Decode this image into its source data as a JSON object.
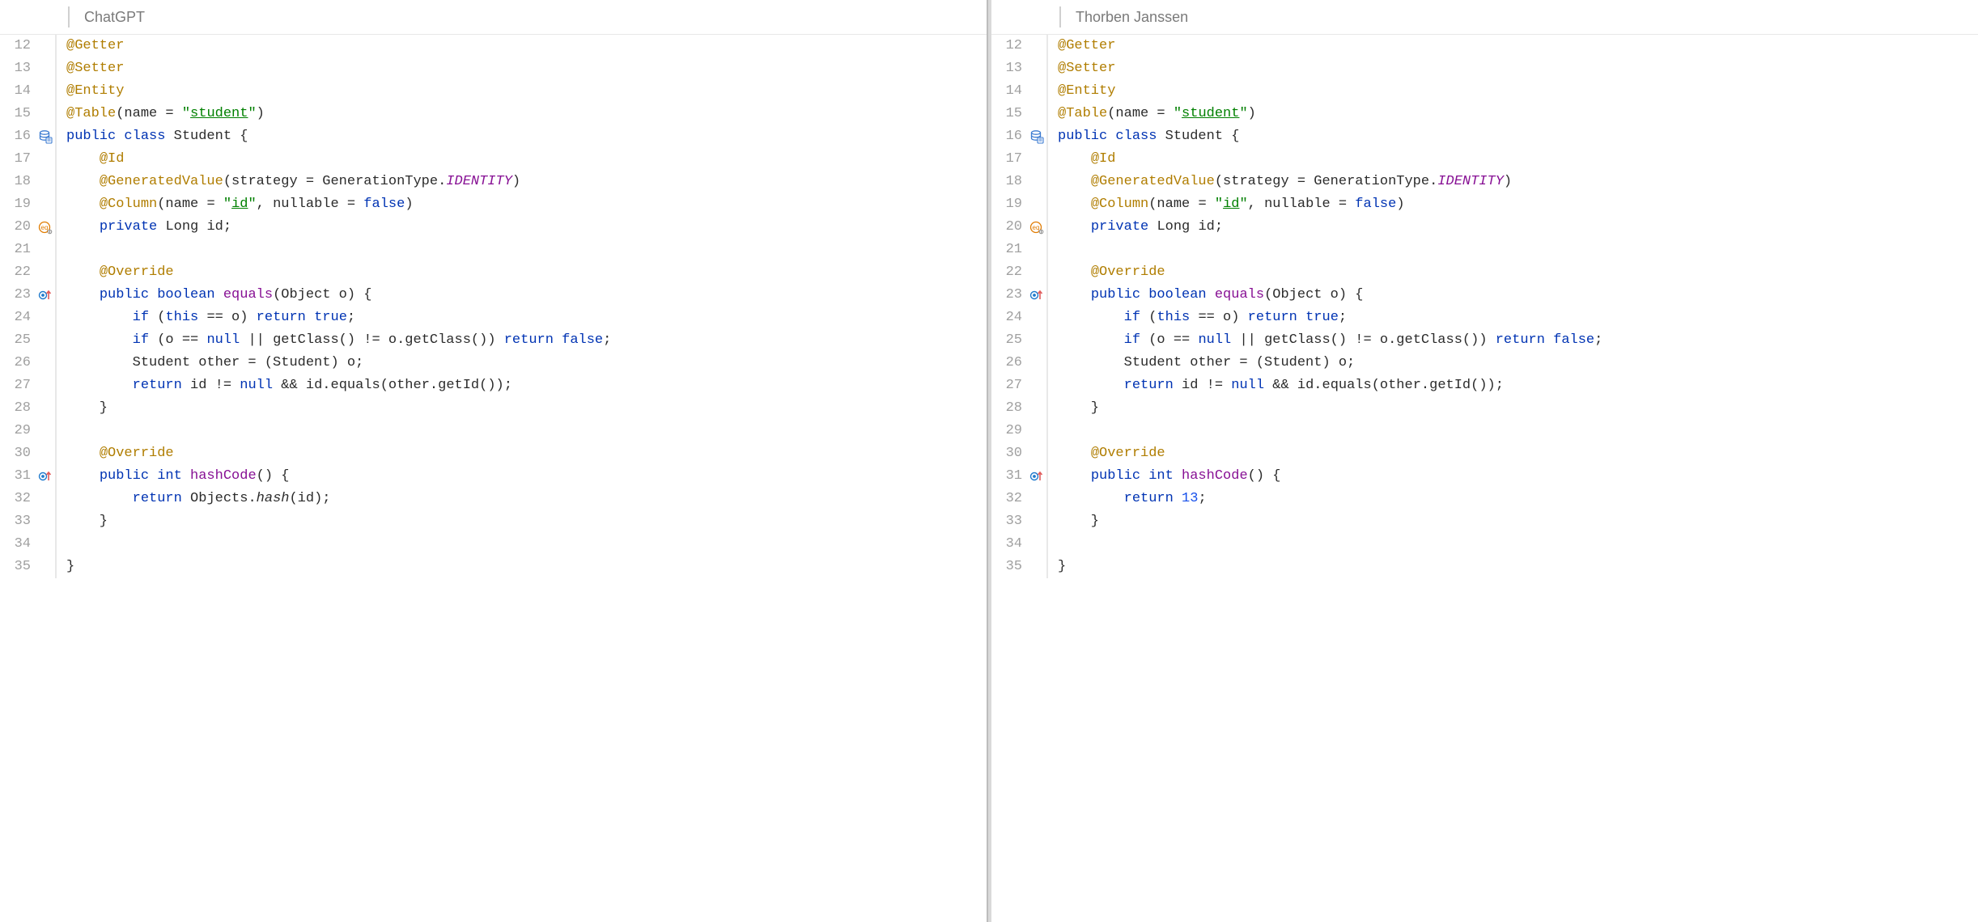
{
  "left": {
    "title": "ChatGPT",
    "lines": [
      {
        "n": 12,
        "ico": null,
        "tokens": [
          [
            "ann",
            "@Getter"
          ]
        ]
      },
      {
        "n": 13,
        "ico": null,
        "tokens": [
          [
            "ann",
            "@Setter"
          ]
        ]
      },
      {
        "n": 14,
        "ico": null,
        "tokens": [
          [
            "ann",
            "@Entity"
          ]
        ]
      },
      {
        "n": 15,
        "ico": null,
        "tokens": [
          [
            "ann",
            "@Table"
          ],
          [
            "p",
            "(name = "
          ],
          [
            "str",
            "\""
          ],
          [
            "strund",
            "student"
          ],
          [
            "str",
            "\""
          ],
          [
            "p",
            ")"
          ]
        ]
      },
      {
        "n": 16,
        "ico": "db",
        "tokens": [
          [
            "kw",
            "public class "
          ],
          [
            "p",
            "Student {"
          ]
        ]
      },
      {
        "n": 17,
        "ico": null,
        "tokens": [
          [
            "p",
            "    "
          ],
          [
            "ann",
            "@Id"
          ]
        ]
      },
      {
        "n": 18,
        "ico": null,
        "tokens": [
          [
            "p",
            "    "
          ],
          [
            "ann",
            "@GeneratedValue"
          ],
          [
            "p",
            "(strategy = GenerationType."
          ],
          [
            "id ital",
            "IDENTITY"
          ],
          [
            "p",
            ")"
          ]
        ]
      },
      {
        "n": 19,
        "ico": null,
        "tokens": [
          [
            "p",
            "    "
          ],
          [
            "ann",
            "@Column"
          ],
          [
            "p",
            "(name = "
          ],
          [
            "str",
            "\""
          ],
          [
            "strund",
            "id"
          ],
          [
            "str",
            "\""
          ],
          [
            "p",
            ", nullable = "
          ],
          [
            "bool",
            "false"
          ],
          [
            "p",
            ")"
          ]
        ]
      },
      {
        "n": 20,
        "ico": "eq",
        "tokens": [
          [
            "p",
            "    "
          ],
          [
            "kw",
            "private "
          ],
          [
            "p",
            "Long id;"
          ]
        ]
      },
      {
        "n": 21,
        "ico": null,
        "tokens": [
          [
            "p",
            ""
          ]
        ]
      },
      {
        "n": 22,
        "ico": null,
        "tokens": [
          [
            "p",
            "    "
          ],
          [
            "ann",
            "@Override"
          ]
        ]
      },
      {
        "n": 23,
        "ico": "ov",
        "tokens": [
          [
            "p",
            "    "
          ],
          [
            "kw",
            "public boolean "
          ],
          [
            "id",
            "equals"
          ],
          [
            "p",
            "(Object o) {"
          ]
        ]
      },
      {
        "n": 24,
        "ico": null,
        "tokens": [
          [
            "p",
            "        "
          ],
          [
            "kw",
            "if "
          ],
          [
            "p",
            "("
          ],
          [
            "kw",
            "this"
          ],
          [
            "p",
            " == o) "
          ],
          [
            "kw",
            "return true"
          ],
          [
            "p",
            ";"
          ]
        ]
      },
      {
        "n": 25,
        "ico": null,
        "tokens": [
          [
            "p",
            "        "
          ],
          [
            "kw",
            "if "
          ],
          [
            "p",
            "(o == "
          ],
          [
            "kw",
            "null"
          ],
          [
            "p",
            " || getClass() != o.getClass()) "
          ],
          [
            "kw",
            "return false"
          ],
          [
            "p",
            ";"
          ]
        ]
      },
      {
        "n": 26,
        "ico": null,
        "tokens": [
          [
            "p",
            "        Student other = (Student) o;"
          ]
        ]
      },
      {
        "n": 27,
        "ico": null,
        "tokens": [
          [
            "p",
            "        "
          ],
          [
            "kw",
            "return "
          ],
          [
            "p",
            "id != "
          ],
          [
            "kw",
            "null"
          ],
          [
            "p",
            " && id.equals(other.getId());"
          ]
        ]
      },
      {
        "n": 28,
        "ico": null,
        "tokens": [
          [
            "p",
            "    }"
          ]
        ]
      },
      {
        "n": 29,
        "ico": null,
        "tokens": [
          [
            "p",
            ""
          ]
        ]
      },
      {
        "n": 30,
        "ico": null,
        "tokens": [
          [
            "p",
            "    "
          ],
          [
            "ann",
            "@Override"
          ]
        ]
      },
      {
        "n": 31,
        "ico": "ov",
        "tokens": [
          [
            "p",
            "    "
          ],
          [
            "kw",
            "public int "
          ],
          [
            "id",
            "hashCode"
          ],
          [
            "p",
            "() {"
          ]
        ]
      },
      {
        "n": 32,
        "ico": null,
        "tokens": [
          [
            "p",
            "        "
          ],
          [
            "kw",
            "return "
          ],
          [
            "p",
            "Objects."
          ],
          [
            "ital",
            "hash"
          ],
          [
            "p",
            "(id);"
          ]
        ]
      },
      {
        "n": 33,
        "ico": null,
        "tokens": [
          [
            "p",
            "    }"
          ]
        ]
      },
      {
        "n": 34,
        "ico": null,
        "tokens": [
          [
            "p",
            ""
          ]
        ]
      },
      {
        "n": 35,
        "ico": null,
        "tokens": [
          [
            "p",
            "}"
          ]
        ]
      }
    ]
  },
  "right": {
    "title": "Thorben Janssen",
    "lines": [
      {
        "n": 12,
        "ico": null,
        "tokens": [
          [
            "ann",
            "@Getter"
          ]
        ]
      },
      {
        "n": 13,
        "ico": null,
        "tokens": [
          [
            "ann",
            "@Setter"
          ]
        ]
      },
      {
        "n": 14,
        "ico": null,
        "tokens": [
          [
            "ann",
            "@Entity"
          ]
        ]
      },
      {
        "n": 15,
        "ico": null,
        "tokens": [
          [
            "ann",
            "@Table"
          ],
          [
            "p",
            "(name = "
          ],
          [
            "str",
            "\""
          ],
          [
            "strund",
            "student"
          ],
          [
            "str",
            "\""
          ],
          [
            "p",
            ")"
          ]
        ]
      },
      {
        "n": 16,
        "ico": "db",
        "tokens": [
          [
            "kw",
            "public class "
          ],
          [
            "p",
            "Student {"
          ]
        ]
      },
      {
        "n": 17,
        "ico": null,
        "tokens": [
          [
            "p",
            "    "
          ],
          [
            "ann",
            "@Id"
          ]
        ]
      },
      {
        "n": 18,
        "ico": null,
        "tokens": [
          [
            "p",
            "    "
          ],
          [
            "ann",
            "@GeneratedValue"
          ],
          [
            "p",
            "(strategy = GenerationType."
          ],
          [
            "id ital",
            "IDENTITY"
          ],
          [
            "p",
            ")"
          ]
        ]
      },
      {
        "n": 19,
        "ico": null,
        "tokens": [
          [
            "p",
            "    "
          ],
          [
            "ann",
            "@Column"
          ],
          [
            "p",
            "(name = "
          ],
          [
            "str",
            "\""
          ],
          [
            "strund",
            "id"
          ],
          [
            "str",
            "\""
          ],
          [
            "p",
            ", nullable = "
          ],
          [
            "bool",
            "false"
          ],
          [
            "p",
            ")"
          ]
        ]
      },
      {
        "n": 20,
        "ico": "eq",
        "tokens": [
          [
            "p",
            "    "
          ],
          [
            "kw",
            "private "
          ],
          [
            "p",
            "Long id;"
          ]
        ]
      },
      {
        "n": 21,
        "ico": null,
        "tokens": [
          [
            "p",
            ""
          ]
        ]
      },
      {
        "n": 22,
        "ico": null,
        "tokens": [
          [
            "p",
            "    "
          ],
          [
            "ann",
            "@Override"
          ]
        ]
      },
      {
        "n": 23,
        "ico": "ov",
        "tokens": [
          [
            "p",
            "    "
          ],
          [
            "kw",
            "public boolean "
          ],
          [
            "id",
            "equals"
          ],
          [
            "p",
            "(Object o) {"
          ]
        ]
      },
      {
        "n": 24,
        "ico": null,
        "tokens": [
          [
            "p",
            "        "
          ],
          [
            "kw",
            "if "
          ],
          [
            "p",
            "("
          ],
          [
            "kw",
            "this"
          ],
          [
            "p",
            " == o) "
          ],
          [
            "kw",
            "return true"
          ],
          [
            "p",
            ";"
          ]
        ]
      },
      {
        "n": 25,
        "ico": null,
        "tokens": [
          [
            "p",
            "        "
          ],
          [
            "kw",
            "if "
          ],
          [
            "p",
            "(o == "
          ],
          [
            "kw",
            "null"
          ],
          [
            "p",
            " || getClass() != o.getClass()) "
          ],
          [
            "kw",
            "return false"
          ],
          [
            "p",
            ";"
          ]
        ]
      },
      {
        "n": 26,
        "ico": null,
        "tokens": [
          [
            "p",
            "        Student other = (Student) o;"
          ]
        ]
      },
      {
        "n": 27,
        "ico": null,
        "tokens": [
          [
            "p",
            "        "
          ],
          [
            "kw",
            "return "
          ],
          [
            "p",
            "id != "
          ],
          [
            "kw",
            "null"
          ],
          [
            "p",
            " && id.equals(other.getId());"
          ]
        ]
      },
      {
        "n": 28,
        "ico": null,
        "tokens": [
          [
            "p",
            "    }"
          ]
        ]
      },
      {
        "n": 29,
        "ico": null,
        "tokens": [
          [
            "p",
            ""
          ]
        ]
      },
      {
        "n": 30,
        "ico": null,
        "tokens": [
          [
            "p",
            "    "
          ],
          [
            "ann",
            "@Override"
          ]
        ]
      },
      {
        "n": 31,
        "ico": "ov",
        "tokens": [
          [
            "p",
            "    "
          ],
          [
            "kw",
            "public int "
          ],
          [
            "id",
            "hashCode"
          ],
          [
            "p",
            "() {"
          ]
        ]
      },
      {
        "n": 32,
        "ico": null,
        "tokens": [
          [
            "p",
            "        "
          ],
          [
            "kw",
            "return "
          ],
          [
            "num",
            "13"
          ],
          [
            "p",
            ";"
          ]
        ]
      },
      {
        "n": 33,
        "ico": null,
        "tokens": [
          [
            "p",
            "    }"
          ]
        ]
      },
      {
        "n": 34,
        "ico": null,
        "tokens": [
          [
            "p",
            ""
          ]
        ]
      },
      {
        "n": 35,
        "ico": null,
        "tokens": [
          [
            "p",
            "}"
          ]
        ]
      }
    ]
  }
}
